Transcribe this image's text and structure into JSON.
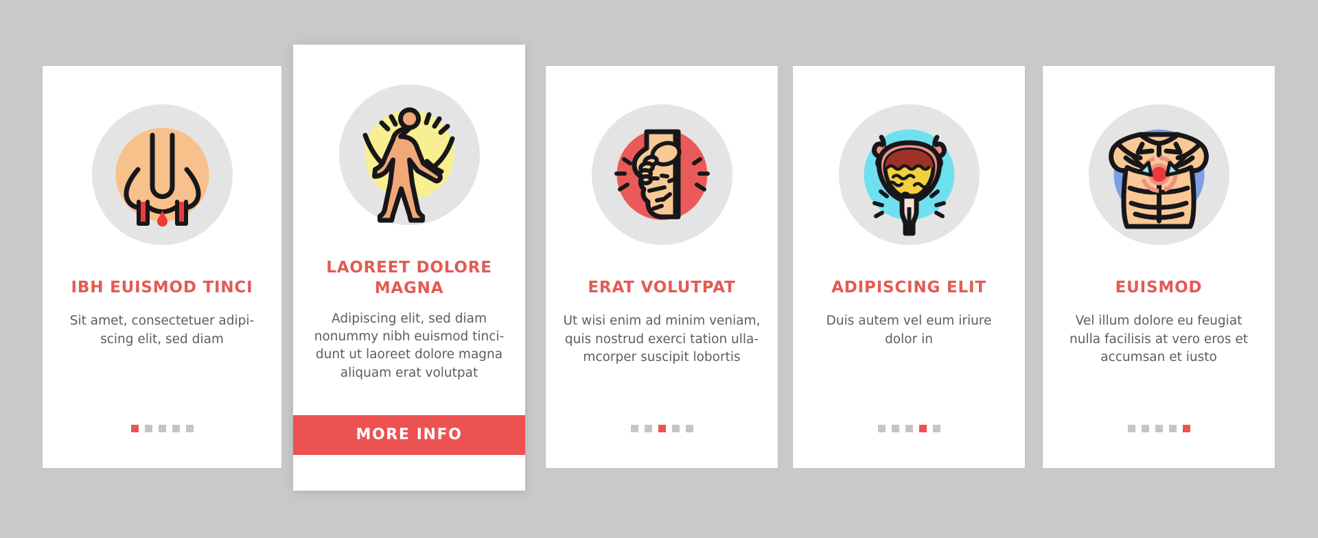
{
  "theme": {
    "page_background": "#c9c9c9",
    "card_background": "#ffffff",
    "accent": "#ec5252",
    "title_color": "#e35a55",
    "body_color": "#5d5d5d",
    "icon_disc": "#e4e4e4",
    "dot_inactive": "#c5c5c5"
  },
  "cards": [
    {
      "icon_name": "bleeding-nose-icon",
      "icon_badge_color": "#f8c08a",
      "title": "IBH EUISMOD TINCI",
      "body": "Sit amet, consectetuer adipi-\nscing elit, sed diam",
      "dots_total": 5,
      "active_dot": 1,
      "featured": false,
      "button_label": null
    },
    {
      "icon_name": "shivering-person-icon",
      "icon_badge_color": "#f7ef90",
      "title": "LAOREET DOLORE MAGNA",
      "body": "Adipiscing elit, sed diam\nnonummy nibh euismod tinci-\ndunt ut laoreet dolore magna\naliquam erat volutpat",
      "dots_total": 5,
      "active_dot": 2,
      "featured": true,
      "button_label": "MORE INFO"
    },
    {
      "icon_name": "painful-foot-icon",
      "icon_badge_color": "#ea5a58",
      "title": "ERAT VOLUTPAT",
      "body": "Ut wisi enim ad minim veniam,\nquis nostrud exerci tation ulla-\nmcorper suscipit lobortis",
      "dots_total": 5,
      "active_dot": 3,
      "featured": false,
      "button_label": null
    },
    {
      "icon_name": "bladder-icon",
      "icon_badge_color": "#6fe0ef",
      "title": "ADIPISCING ELIT",
      "body": "Duis autem vel eum iriure\ndolor in",
      "dots_total": 5,
      "active_dot": 4,
      "featured": false,
      "button_label": null
    },
    {
      "icon_name": "chest-pain-torso-icon",
      "icon_badge_color": "#7d9fe8",
      "title": "EUISMOD",
      "body": "Vel illum dolore eu feugiat\nnulla facilisis at vero eros et\naccumsan et iusto",
      "dots_total": 5,
      "active_dot": 5,
      "featured": false,
      "button_label": null
    }
  ]
}
